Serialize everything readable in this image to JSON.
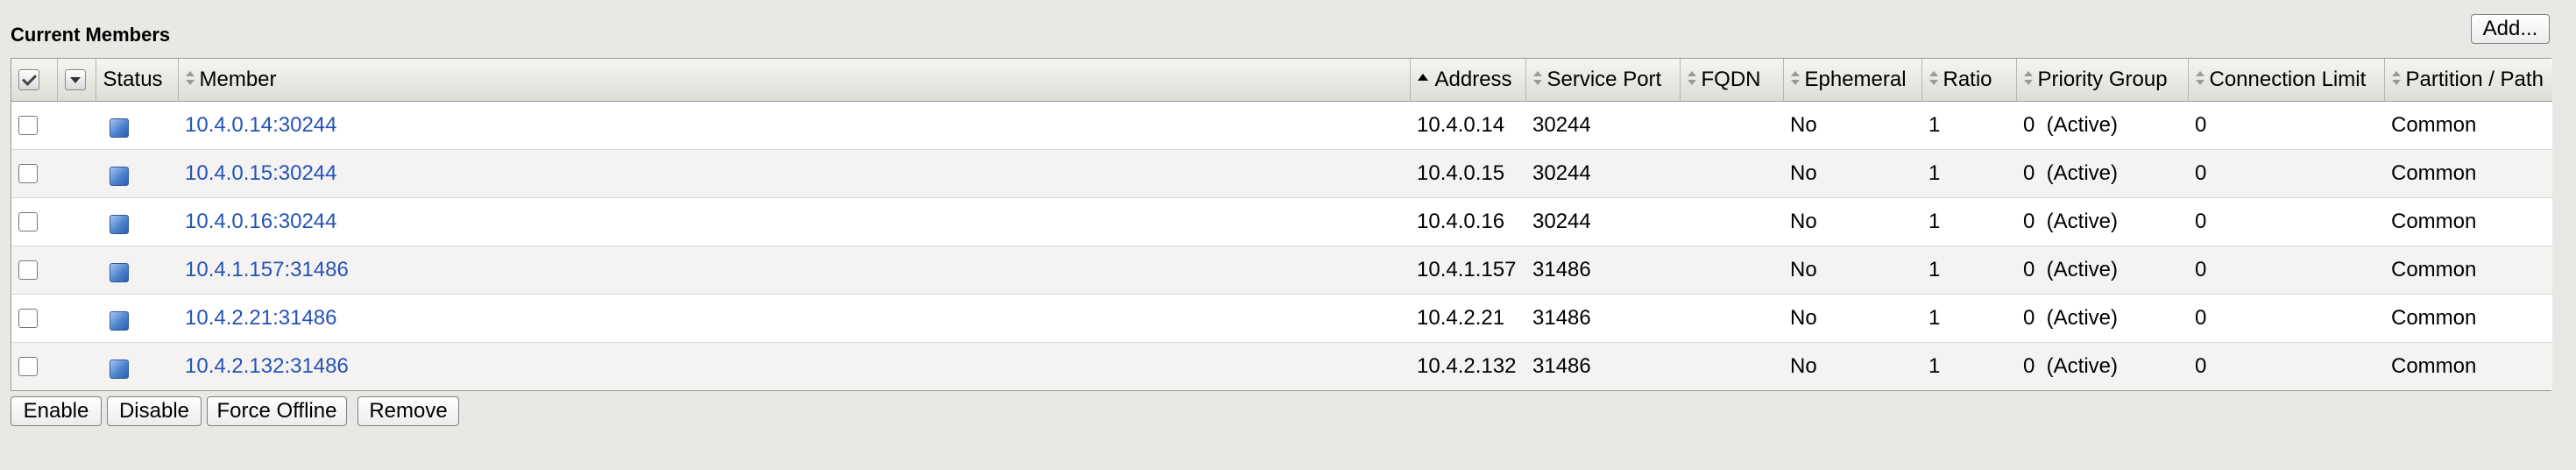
{
  "section": {
    "title": "Current Members",
    "add_label": "Add..."
  },
  "table": {
    "headers": {
      "status": "Status",
      "member": "Member",
      "address": "Address",
      "service_port": "Service Port",
      "fqdn": "FQDN",
      "ephemeral": "Ephemeral",
      "ratio": "Ratio",
      "priority_group": "Priority Group",
      "connection_limit": "Connection Limit",
      "partition_path": "Partition / Path"
    },
    "sorted_column": "address",
    "sort_direction": "ascending",
    "status_icon_color": "#4d82cf",
    "link_color": "#2452b8",
    "rows": [
      {
        "member": "10.4.0.14:30244",
        "address": "10.4.0.14",
        "service_port": "30244",
        "fqdn": "",
        "ephemeral": "No",
        "ratio": "1",
        "priority_group": "0  (Active)",
        "connection_limit": "0",
        "partition_path": "Common"
      },
      {
        "member": "10.4.0.15:30244",
        "address": "10.4.0.15",
        "service_port": "30244",
        "fqdn": "",
        "ephemeral": "No",
        "ratio": "1",
        "priority_group": "0  (Active)",
        "connection_limit": "0",
        "partition_path": "Common"
      },
      {
        "member": "10.4.0.16:30244",
        "address": "10.4.0.16",
        "service_port": "30244",
        "fqdn": "",
        "ephemeral": "No",
        "ratio": "1",
        "priority_group": "0  (Active)",
        "connection_limit": "0",
        "partition_path": "Common"
      },
      {
        "member": "10.4.1.157:31486",
        "address": "10.4.1.157",
        "service_port": "31486",
        "fqdn": "",
        "ephemeral": "No",
        "ratio": "1",
        "priority_group": "0  (Active)",
        "connection_limit": "0",
        "partition_path": "Common"
      },
      {
        "member": "10.4.2.21:31486",
        "address": "10.4.2.21",
        "service_port": "31486",
        "fqdn": "",
        "ephemeral": "No",
        "ratio": "1",
        "priority_group": "0  (Active)",
        "connection_limit": "0",
        "partition_path": "Common"
      },
      {
        "member": "10.4.2.132:31486",
        "address": "10.4.2.132",
        "service_port": "31486",
        "fqdn": "",
        "ephemeral": "No",
        "ratio": "1",
        "priority_group": "0  (Active)",
        "connection_limit": "0",
        "partition_path": "Common"
      }
    ]
  },
  "actions": {
    "enable": "Enable",
    "disable": "Disable",
    "force_offline": "Force Offline",
    "remove": "Remove"
  }
}
